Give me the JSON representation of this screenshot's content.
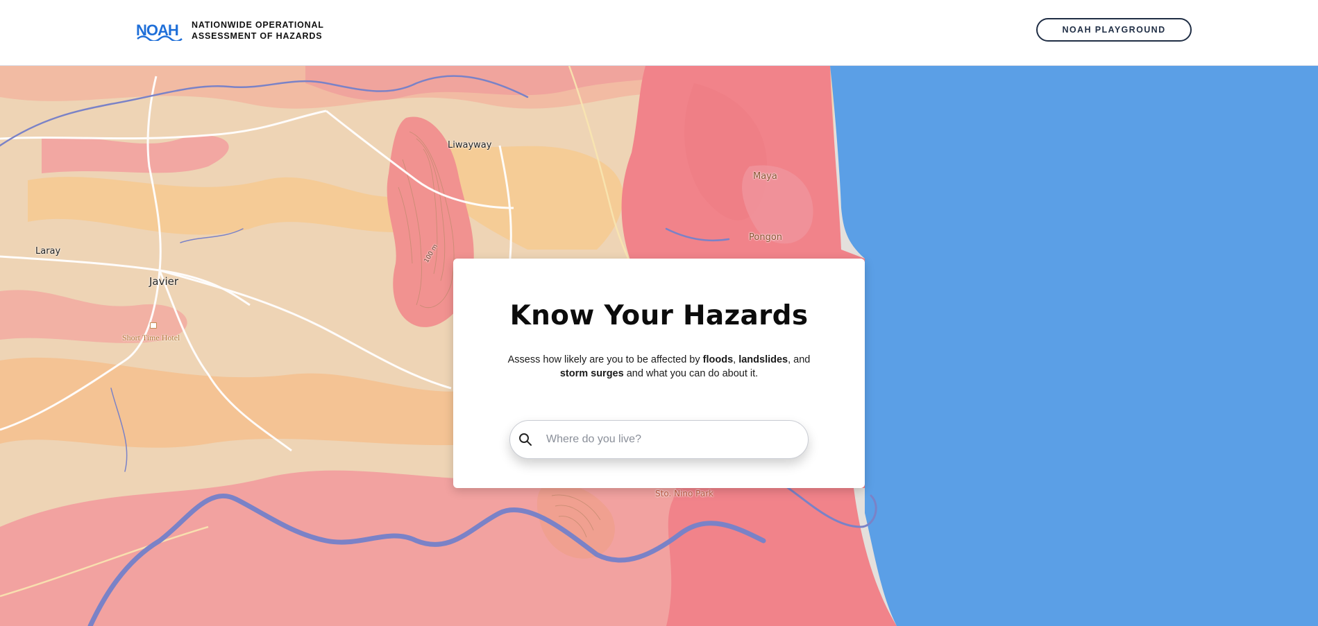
{
  "header": {
    "logo_text": "NOAH",
    "org_line1": "NATIONWIDE OPERATIONAL",
    "org_line2": "ASSESSMENT OF HAZARDS",
    "playground_label": "NOAH PLAYGROUND"
  },
  "map": {
    "places": {
      "liwayway": "Liwayway",
      "maya": "Maya",
      "pongon": "Pongon",
      "laray": "Laray",
      "javier": "Javier",
      "hotel": "Short Time Hotel",
      "park": "Sto. Nino Park",
      "contour": "100 m"
    }
  },
  "card": {
    "title": "Know Your Hazards",
    "desc_before": "Assess how likely are you to be affected by ",
    "floods": "floods",
    "comma1": ", ",
    "landslides": "landslides",
    "and": ", and ",
    "storm_surges": "storm surges",
    "desc_after": " and what you can do about it.",
    "search_placeholder": "Where do you live?"
  },
  "colors": {
    "sea": "#5b9fe6",
    "hazard_high": "#f1828a",
    "hazard_mid": "#f4a3a0",
    "hazard_low": "#f6c98f",
    "land": "#e3dfdb",
    "river": "#7a82c7"
  }
}
